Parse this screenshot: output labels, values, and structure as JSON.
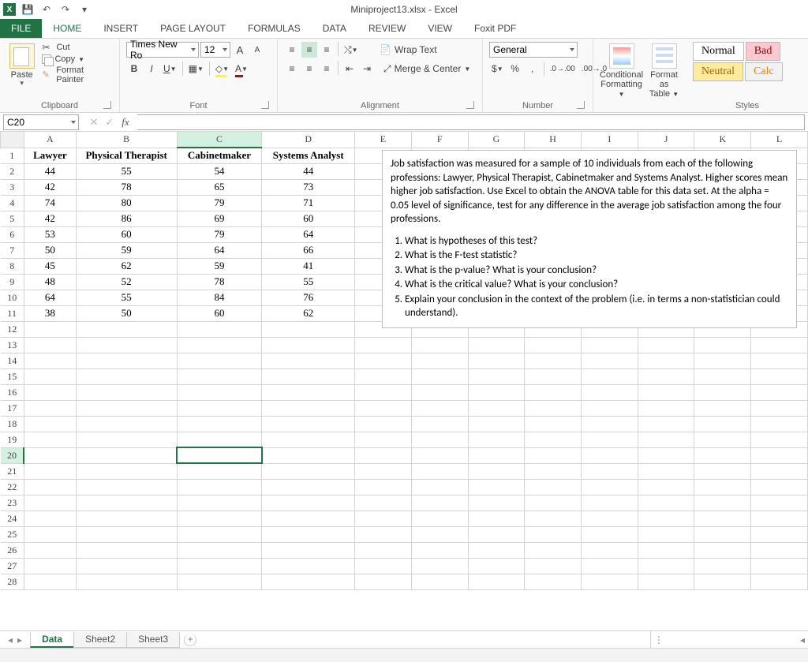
{
  "app": {
    "title": "Miniproject13.xlsx - Excel"
  },
  "qat": {
    "save": "💾",
    "undo": "↶",
    "redo": "↷",
    "touch": "▦"
  },
  "tabs": [
    "FILE",
    "HOME",
    "INSERT",
    "PAGE LAYOUT",
    "FORMULAS",
    "DATA",
    "REVIEW",
    "VIEW",
    "Foxit PDF"
  ],
  "active_tab": "HOME",
  "ribbon": {
    "clipboard": {
      "paste": "Paste",
      "cut": "Cut",
      "copy": "Copy",
      "painter": "Format Painter",
      "label": "Clipboard"
    },
    "font": {
      "name": "Times New Ro",
      "size": "12",
      "label": "Font"
    },
    "alignment": {
      "wrap": "Wrap Text",
      "merge": "Merge & Center",
      "label": "Alignment"
    },
    "number": {
      "format": "General",
      "label": "Number"
    },
    "cond": {
      "cf": "Conditional Formatting",
      "cf1": "Conditional",
      "cf2": "Formatting",
      "fat": "Format as Table",
      "fat1": "Format as",
      "fat2": "Table"
    },
    "styles": {
      "normal": "Normal",
      "bad": "Bad",
      "neutral": "Neutral",
      "calc": "Calc",
      "label": "Styles"
    }
  },
  "namebox": "C20",
  "columns": [
    "A",
    "B",
    "C",
    "D",
    "E",
    "F",
    "G",
    "H",
    "I",
    "J",
    "K",
    "L"
  ],
  "selected_col": "C",
  "selected_row": 20,
  "data_headers": [
    "Lawyer",
    "Physical Therapist",
    "Cabinetmaker",
    "Systems Analyst"
  ],
  "data_rows": [
    [
      44,
      55,
      54,
      44
    ],
    [
      42,
      78,
      65,
      73
    ],
    [
      74,
      80,
      79,
      71
    ],
    [
      42,
      86,
      69,
      60
    ],
    [
      53,
      60,
      79,
      64
    ],
    [
      50,
      59,
      64,
      66
    ],
    [
      45,
      62,
      59,
      41
    ],
    [
      48,
      52,
      78,
      55
    ],
    [
      64,
      55,
      84,
      76
    ],
    [
      38,
      50,
      60,
      62
    ]
  ],
  "total_rows": 28,
  "textbox": {
    "para": "Job satisfaction was measured for a sample of 10 individuals from each of the following professions: Lawyer, Physical Therapist, Cabinetmaker and Systems Analyst.  Higher scores mean higher job satisfaction. Use Excel to obtain the ANOVA table for this data set. At the alpha = 0.05 level of significance, test for any difference in the average job satisfaction among the four professions.",
    "q1": "What is hypotheses of this test?",
    "q2": "What is the F-test statistic?",
    "q3": "What is the p-value?  What is your conclusion?",
    "q4": "What is the critical value?  What is your conclusion?",
    "q5": "Explain your conclusion in the context of the problem (i.e. in terms a non-statistician could understand)."
  },
  "sheets": [
    "Data",
    "Sheet2",
    "Sheet3"
  ],
  "active_sheet": "Data"
}
